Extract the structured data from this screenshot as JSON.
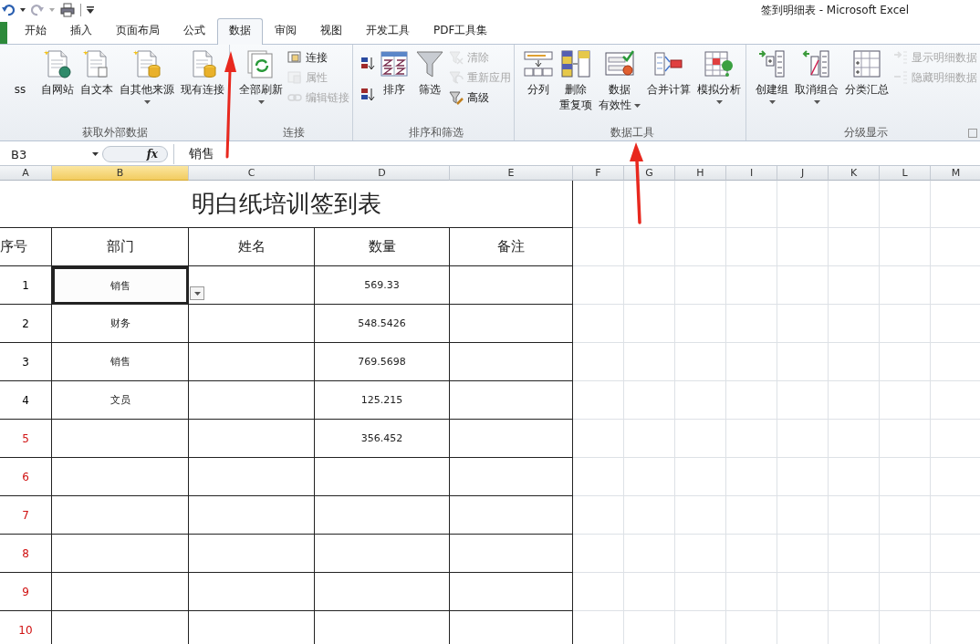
{
  "window": {
    "title": "签到明细表  -  Microsoft Excel"
  },
  "tabs": [
    {
      "label": "开始",
      "selected": false
    },
    {
      "label": "插入",
      "selected": false
    },
    {
      "label": "页面布局",
      "selected": false
    },
    {
      "label": "公式",
      "selected": false
    },
    {
      "label": "数据",
      "selected": true
    },
    {
      "label": "审阅",
      "selected": false
    },
    {
      "label": "视图",
      "selected": false
    },
    {
      "label": "开发工具",
      "selected": false
    },
    {
      "label": "PDF工具集",
      "selected": false
    }
  ],
  "ribbon": {
    "groups": [
      {
        "label": "获取外部数据",
        "buttons": [
          {
            "kind": "large",
            "lines": [
              "ss"
            ],
            "disabled": false,
            "dropdown": false
          },
          {
            "kind": "large",
            "lines": [
              "自网站"
            ],
            "disabled": false,
            "dropdown": false
          },
          {
            "kind": "large",
            "lines": [
              "自文本"
            ],
            "disabled": false,
            "dropdown": false
          },
          {
            "kind": "large",
            "lines": [
              "自其他来源"
            ],
            "disabled": false,
            "dropdown": true
          },
          {
            "kind": "large",
            "lines": [
              "现有连接"
            ],
            "disabled": false,
            "dropdown": false
          }
        ]
      },
      {
        "label": "连接",
        "buttons": [
          {
            "kind": "large",
            "lines": [
              "全部刷新"
            ],
            "disabled": false,
            "dropdown": true
          },
          {
            "kind": "small",
            "lines": [
              "连接"
            ],
            "disabled": false,
            "dropdown": false
          },
          {
            "kind": "small",
            "lines": [
              "属性"
            ],
            "disabled": true,
            "dropdown": false
          },
          {
            "kind": "small",
            "lines": [
              "编辑链接"
            ],
            "disabled": true,
            "dropdown": false
          }
        ]
      },
      {
        "label": "排序和筛选",
        "buttons": [
          {
            "kind": "icon",
            "disabled": false
          },
          {
            "kind": "icon",
            "disabled": false
          },
          {
            "kind": "large",
            "lines": [
              "排序"
            ],
            "disabled": false,
            "dropdown": false
          },
          {
            "kind": "large",
            "lines": [
              "筛选"
            ],
            "disabled": false,
            "dropdown": false
          },
          {
            "kind": "small",
            "lines": [
              "清除"
            ],
            "disabled": true,
            "dropdown": false
          },
          {
            "kind": "small",
            "lines": [
              "重新应用"
            ],
            "disabled": true,
            "dropdown": false
          },
          {
            "kind": "small",
            "lines": [
              "高级"
            ],
            "disabled": false,
            "dropdown": false
          }
        ]
      },
      {
        "label": "数据工具",
        "buttons": [
          {
            "kind": "large",
            "lines": [
              "分列"
            ],
            "disabled": false,
            "dropdown": false
          },
          {
            "kind": "large",
            "lines": [
              "删除",
              "重复项"
            ],
            "disabled": false,
            "dropdown": false
          },
          {
            "kind": "large",
            "lines": [
              "数据",
              "有效性"
            ],
            "disabled": false,
            "dropdown": true
          },
          {
            "kind": "large",
            "lines": [
              "合并计算"
            ],
            "disabled": false,
            "dropdown": false
          },
          {
            "kind": "large",
            "lines": [
              "模拟分析"
            ],
            "disabled": false,
            "dropdown": true
          }
        ]
      },
      {
        "label": "分级显示",
        "launcher": true,
        "buttons": [
          {
            "kind": "large",
            "lines": [
              "创建组"
            ],
            "disabled": false,
            "dropdown": true
          },
          {
            "kind": "large",
            "lines": [
              "取消组合"
            ],
            "disabled": false,
            "dropdown": true
          },
          {
            "kind": "large",
            "lines": [
              "分类汇总"
            ],
            "disabled": false,
            "dropdown": false
          },
          {
            "kind": "small",
            "lines": [
              "显示明细数据"
            ],
            "disabled": true,
            "dropdown": false
          },
          {
            "kind": "small",
            "lines": [
              "隐藏明细数据"
            ],
            "disabled": true,
            "dropdown": false
          }
        ]
      }
    ]
  },
  "name_box": {
    "value": "B3"
  },
  "formula_bar": {
    "function_label": "fx",
    "value": "销售"
  },
  "sheet": {
    "columns": [
      {
        "label": "A",
        "selected": false
      },
      {
        "label": "B",
        "selected": true
      },
      {
        "label": "C",
        "selected": false
      },
      {
        "label": "D",
        "selected": false
      },
      {
        "label": "E",
        "selected": false
      },
      {
        "label": "F",
        "selected": false
      },
      {
        "label": "G",
        "selected": false
      },
      {
        "label": "H",
        "selected": false
      },
      {
        "label": "I",
        "selected": false
      },
      {
        "label": "J",
        "selected": false
      },
      {
        "label": "K",
        "selected": false
      },
      {
        "label": "L",
        "selected": false
      },
      {
        "label": "M",
        "selected": false
      }
    ],
    "title": "明白纸培训签到表",
    "header": [
      "序号",
      "部门",
      "姓名",
      "数量",
      "备注"
    ],
    "rows": [
      {
        "number": "1",
        "color": "#000000",
        "department": "销售",
        "quantity": "569.33",
        "selected": true
      },
      {
        "number": "2",
        "color": "#000000",
        "department": "财务",
        "quantity": "548.5426",
        "selected": false
      },
      {
        "number": "3",
        "color": "#000000",
        "department": "销售",
        "quantity": "769.5698",
        "selected": false
      },
      {
        "number": "4",
        "color": "#000000",
        "department": "文员",
        "quantity": "125.215",
        "selected": false
      },
      {
        "number": "5",
        "color": "#d01010",
        "quantity": "356.452",
        "selected": false
      },
      {
        "number": "6",
        "color": "#d01010",
        "selected": false
      },
      {
        "number": "7",
        "color": "#d01010",
        "selected": false
      },
      {
        "number": "8",
        "color": "#d01010",
        "selected": false
      },
      {
        "number": "9",
        "color": "#d01010",
        "selected": false
      },
      {
        "number": "10",
        "color": "#d01010",
        "selected": false
      }
    ]
  }
}
